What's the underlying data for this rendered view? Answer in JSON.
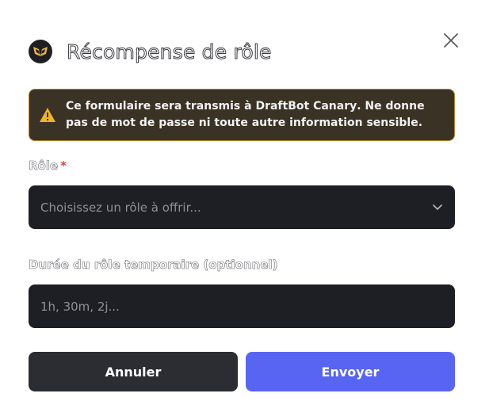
{
  "modal": {
    "title": "Récompense de rôle",
    "logo_icon": "draftbot-logo-icon",
    "close_icon": "close-icon"
  },
  "warning": {
    "icon": "warning-triangle-icon",
    "text_before": "Ce formulaire sera transmis à ",
    "bot_name": "DraftBot Canary",
    "text_after": ". Ne donne pas de mot de passe ni toute autre information sensible.",
    "border_color": "#b9862a",
    "background_color": "#3a3224"
  },
  "role_field": {
    "label": "Rôle",
    "required_mark": "*",
    "placeholder": "Choisissez un rôle à offrir...",
    "icon": "chevron-down-icon"
  },
  "duration_field": {
    "label": "Durée du rôle temporaire (optionnel)",
    "placeholder": "1h, 30m, 2j..."
  },
  "buttons": {
    "cancel_label": "Annuler",
    "submit_label": "Envoyer",
    "submit_color": "#5865f2"
  }
}
